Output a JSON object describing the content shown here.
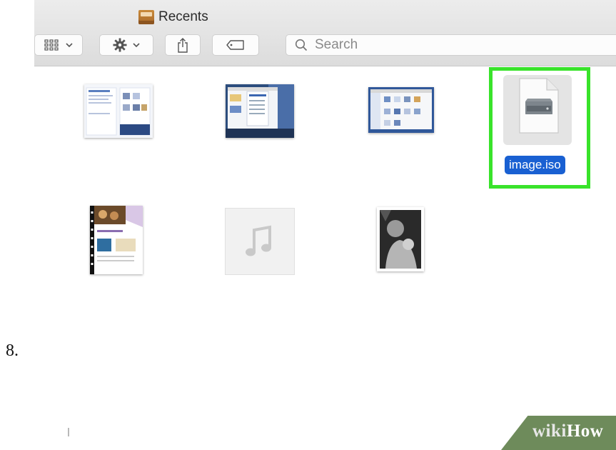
{
  "window": {
    "title": "Recents",
    "search": {
      "placeholder": "Search",
      "value": ""
    }
  },
  "toolbar": {
    "view_button_icon": "icon-view-grid-icon",
    "action_button_icon": "gear-icon",
    "share_button_icon": "share-icon",
    "tag_button_icon": "tag-icon"
  },
  "files": [
    {
      "name": "",
      "icon": "document-thumbnail"
    },
    {
      "name": "",
      "icon": "screenshot-thumbnail"
    },
    {
      "name": "",
      "icon": "screenshot-thumbnail"
    },
    {
      "name": "image.iso",
      "icon": "disk-image-icon",
      "selected": true
    },
    {
      "name": "",
      "icon": "brochure-thumbnail"
    },
    {
      "name": "",
      "icon": "music-file-icon"
    },
    {
      "name": "",
      "icon": "photo-thumbnail"
    }
  ],
  "highlight_color": "#39e32b",
  "selection_color": "#1960d2",
  "step_number": "8.",
  "watermark": {
    "part1": "wiki",
    "part2": "How"
  }
}
